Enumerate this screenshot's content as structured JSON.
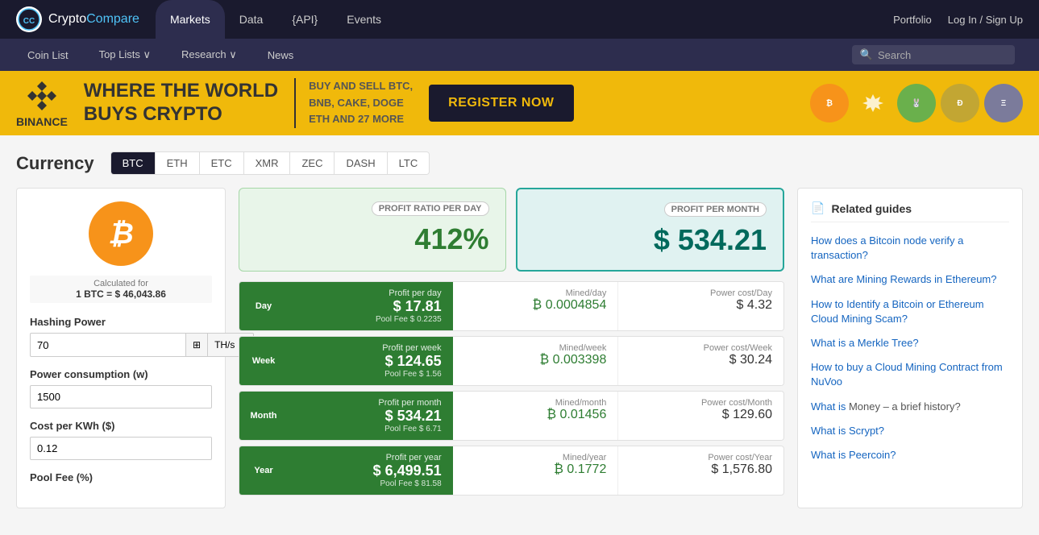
{
  "topNav": {
    "logo": "CryptoCompare",
    "logoHighlight": "Compare",
    "tabs": [
      {
        "label": "Markets",
        "active": true
      },
      {
        "label": "Data",
        "active": false
      },
      {
        "label": "{API}",
        "active": false
      },
      {
        "label": "Events",
        "active": false
      }
    ],
    "rightLinks": [
      "Portfolio",
      "Log In / Sign Up"
    ]
  },
  "secondNav": {
    "items": [
      "Coin List",
      "Top Lists ∨",
      "Research ∨",
      "News"
    ],
    "searchPlaceholder": "Search"
  },
  "banner": {
    "logoText": "BINANCE",
    "title1": "WHERE THE WORLD",
    "title2": "BUYS CRYPTO",
    "subtitle": "BUY AND SELL BTC,\nBNB, CAKE, DOGE\nETH AND 27 MORE",
    "buttonText": "REGISTER NOW"
  },
  "currency": {
    "title": "Currency",
    "tabs": [
      "BTC",
      "ETH",
      "ETC",
      "XMR",
      "ZEC",
      "DASH",
      "LTC"
    ],
    "activeTab": "BTC"
  },
  "calc": {
    "btcSymbol": "₿",
    "rateLabel": "Calculated for",
    "rateValue": "1 BTC = $ 46,043.86",
    "hashingPowerLabel": "Hashing Power",
    "hashingPowerValue": "70",
    "hashingUnit": "TH/s",
    "powerConsumptionLabel": "Power consumption (w)",
    "powerConsumptionValue": "1500",
    "costLabel": "Cost per KWh ($)",
    "costValue": "0.12",
    "poolFeeLabel": "Pool Fee (%)"
  },
  "profitCards": {
    "dayLabel": "PROFIT RATIO PER DAY",
    "dayValue": "412%",
    "monthLabel": "PROFIT PER MONTH",
    "monthValue": "$ 534.21"
  },
  "miningRows": [
    {
      "period": "Day",
      "profitTitle": "Profit per day",
      "profitValue": "$ 17.81",
      "poolFee": "Pool Fee $ 0.2235",
      "minedLabel": "Mined/day",
      "minedValue": "₿ 0.0004854",
      "powerLabel": "Power cost/Day",
      "powerValue": "$ 4.32"
    },
    {
      "period": "Week",
      "profitTitle": "Profit per week",
      "profitValue": "$ 124.65",
      "poolFee": "Pool Fee $ 1.56",
      "minedLabel": "Mined/week",
      "minedValue": "₿ 0.003398",
      "powerLabel": "Power cost/Week",
      "powerValue": "$ 30.24"
    },
    {
      "period": "Month",
      "profitTitle": "Profit per month",
      "profitValue": "$ 534.21",
      "poolFee": "Pool Fee $ 6.71",
      "minedLabel": "Mined/month",
      "minedValue": "₿ 0.01456",
      "powerLabel": "Power cost/Month",
      "powerValue": "$ 129.60"
    },
    {
      "period": "Year",
      "profitTitle": "Profit per year",
      "profitValue": "$ 6,499.51",
      "poolFee": "Pool Fee $ 81.58",
      "minedLabel": "Mined/year",
      "minedValue": "₿ 0.1772",
      "powerLabel": "Power cost/Year",
      "powerValue": "$ 1,576.80"
    }
  ],
  "guides": {
    "title": "Related guides",
    "items": [
      {
        "link": "How does a Bitcoin node verify a transaction?",
        "text": ""
      },
      {
        "link": "What are Mining Rewards in Ethereum?",
        "text": ""
      },
      {
        "link": "How to Identify a Bitcoin or Ethereum Cloud Mining Scam?",
        "text": ""
      },
      {
        "link": "What is a Merkle Tree?",
        "text": ""
      },
      {
        "link": "How to buy a Cloud Mining Contract from NuVoo",
        "text": ""
      },
      {
        "link": "What is",
        "suffix": " Money – a brief history?"
      },
      {
        "link": "What is Scrypt?",
        "text": ""
      },
      {
        "link": "What is Peercoin?",
        "text": ""
      }
    ]
  },
  "coins": [
    {
      "symbol": "₿",
      "color": "#f7931a"
    },
    {
      "symbol": "♦",
      "color": "#f0b90b"
    },
    {
      "symbol": "🐰",
      "color": "#69b3a2"
    },
    {
      "symbol": "Ð",
      "color": "#c2a633"
    },
    {
      "symbol": "Ξ",
      "color": "#7b7b9b"
    }
  ]
}
